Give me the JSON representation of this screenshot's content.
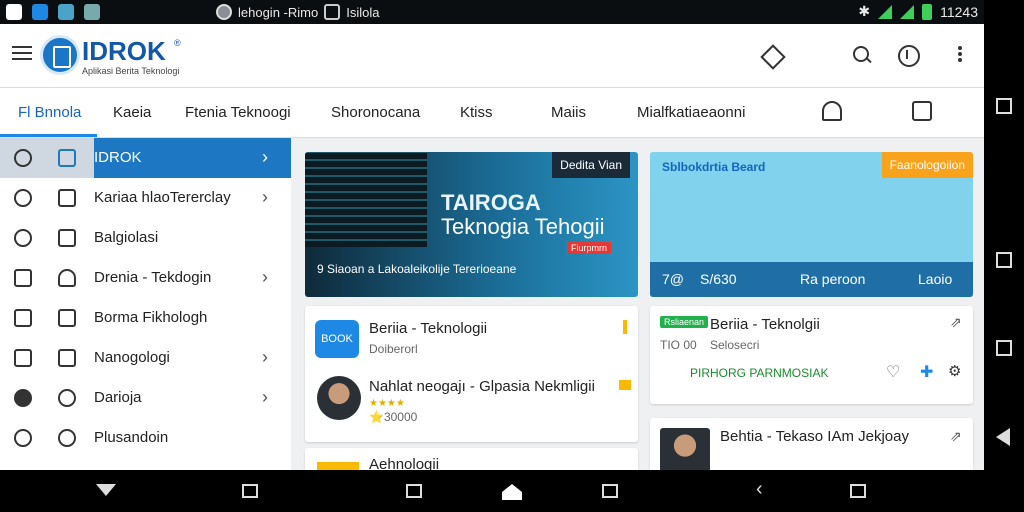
{
  "status": {
    "title": "lehogin -Rimo",
    "app": "Isilola",
    "time": "11243"
  },
  "appbar": {
    "logo": "IDROK",
    "subtitle": "Aplikasi Berita Teknologi"
  },
  "tabs": [
    "Fl Bnnola",
    "Kaeia",
    "Ftenia Teknoogi",
    "Shoronocana",
    "Ktiss",
    "Maiis",
    "Mialfkatiaeaonni"
  ],
  "sidebar": {
    "items": [
      {
        "label": "IDROK",
        "chevron": "›"
      },
      {
        "label": "Kariaa hlaoTererclay",
        "chevron": "›"
      },
      {
        "label": "Balgiolasi",
        "chevron": ""
      },
      {
        "label": "Drenia - Tekdogin",
        "chevron": "›"
      },
      {
        "label": "Borma Fikhologh",
        "chevron": ""
      },
      {
        "label": "Nanogologi",
        "chevron": "›"
      },
      {
        "label": "Darioja",
        "chevron": "›"
      },
      {
        "label": "Plusandoin",
        "chevron": ""
      }
    ]
  },
  "hero": {
    "badge": "Dedita Vian",
    "title1": "TAIROGA",
    "title2": "Teknogia Tehogii",
    "tag": "Fiurpmrn",
    "caption": "9 Siaoan a Lakoaleikolije Tererioeane"
  },
  "featured": {
    "title": "Sblbokdrtia Beard",
    "badge": "Faanologoiion",
    "left": "7@",
    "count": "S/630",
    "action1": "Ra peroon",
    "action2": "Laoio"
  },
  "cards": [
    {
      "pill": "BOOK",
      "title": "Beriia - Teknologii",
      "sub": "Doiberorl"
    },
    {
      "title": "Nahlat neogajı - Glpasia Nekmligii",
      "stars": "★★★★",
      "sub": "⭐30000"
    },
    {
      "title": "Aehnologii"
    },
    {
      "tag": "Rsliaenan",
      "title": "Beriia - Teknolgii",
      "meta1": "TIO 00",
      "meta2": "Selosecri",
      "green": "PIRHORG PARNMOSIAK"
    },
    {
      "title": "Behtia - Tekaso IAm Jekjoay"
    }
  ]
}
